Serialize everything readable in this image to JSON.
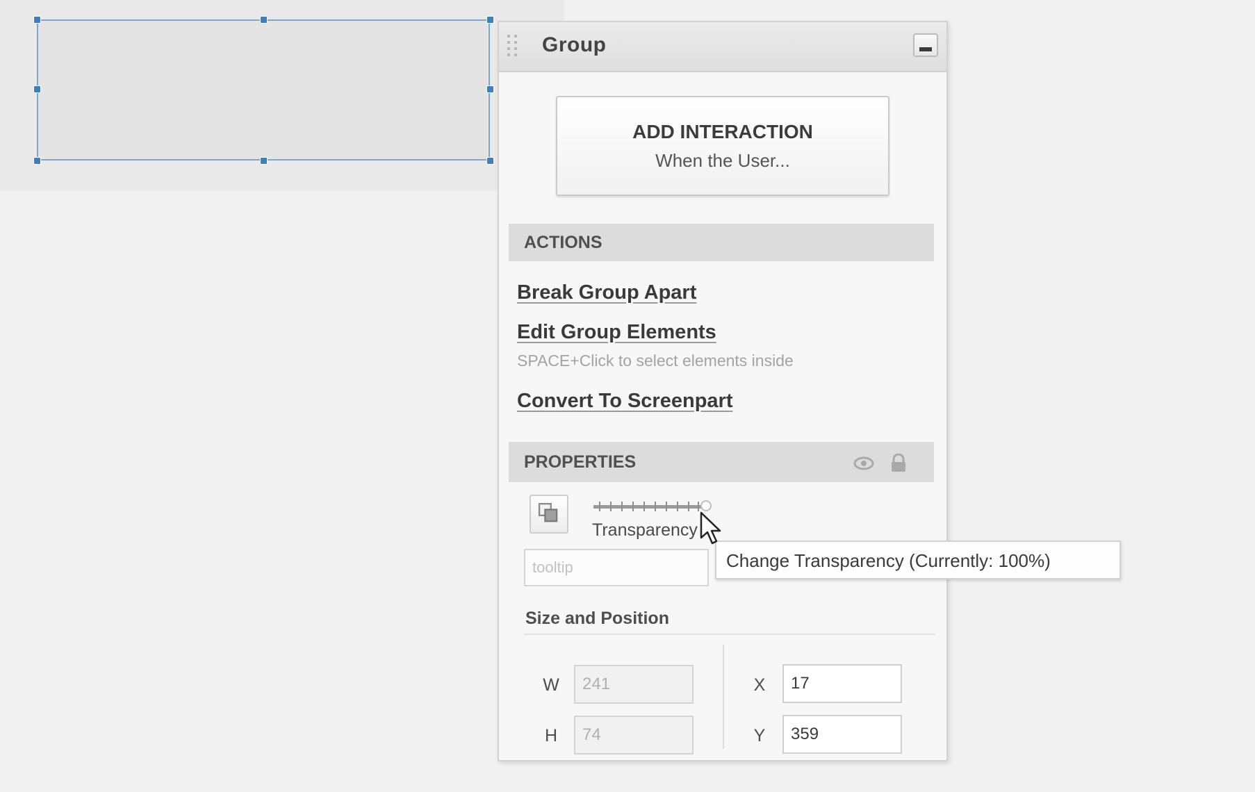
{
  "panel": {
    "title": "Group",
    "add_interaction": {
      "title": "ADD INTERACTION",
      "subtitle": "When the User..."
    },
    "actions": {
      "header": "ACTIONS",
      "items": [
        {
          "label": "Break Group Apart"
        },
        {
          "label": "Edit Group Elements",
          "hint": "SPACE+Click to select elements inside"
        },
        {
          "label": "Convert To Screenpart"
        }
      ]
    },
    "properties": {
      "header": "PROPERTIES",
      "icons": [
        "eye-icon",
        "lock-icon",
        "layers-icon"
      ],
      "transparency": {
        "label": "Transparency",
        "value_percent": 100
      },
      "tooltip_field": {
        "placeholder": "tooltip",
        "value": ""
      },
      "size_position": {
        "title": "Size and Position",
        "w": {
          "label": "W",
          "value": "241"
        },
        "h": {
          "label": "H",
          "value": "74"
        },
        "x": {
          "label": "X",
          "value": "17"
        },
        "y": {
          "label": "Y",
          "value": "359"
        }
      }
    }
  },
  "tooltip": {
    "text": "Change Transparency (Currently: 100%)"
  },
  "colors": {
    "selection": "#3d7fbf",
    "panel_bg": "#f7f7f7",
    "section_bg": "#dcdcdc"
  }
}
